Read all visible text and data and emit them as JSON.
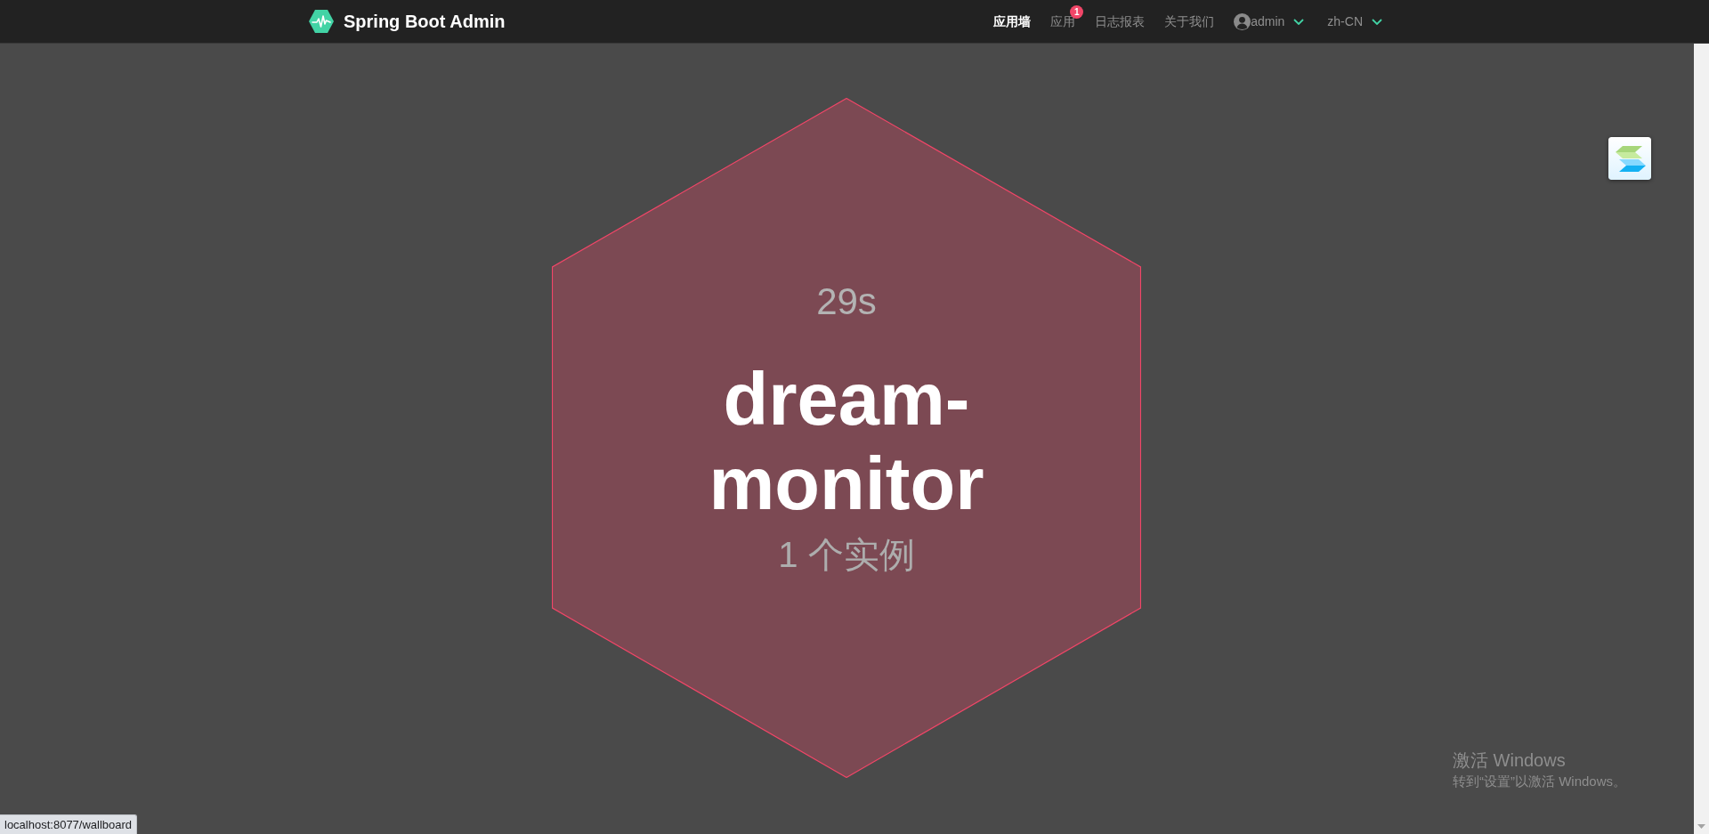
{
  "navbar": {
    "brand": "Spring Boot Admin",
    "items": [
      {
        "label": "应用墙",
        "selected": true
      },
      {
        "label": "应用",
        "selected": false,
        "badge": "1"
      },
      {
        "label": "日志报表",
        "selected": false
      },
      {
        "label": "关于我们",
        "selected": false
      }
    ],
    "user_menu": {
      "label": "admin"
    },
    "language_menu": {
      "label": "zh-CN"
    }
  },
  "wallboard": {
    "applications": [
      {
        "color": "#f14668",
        "time": "29s",
        "name": "dream-monitor",
        "instances": "1 个实例"
      }
    ]
  },
  "status_url": "localhost:8077/wallboard",
  "os_notice": {
    "title": "激活 Windows",
    "message": "转到“设置”以激活 Windows。"
  }
}
